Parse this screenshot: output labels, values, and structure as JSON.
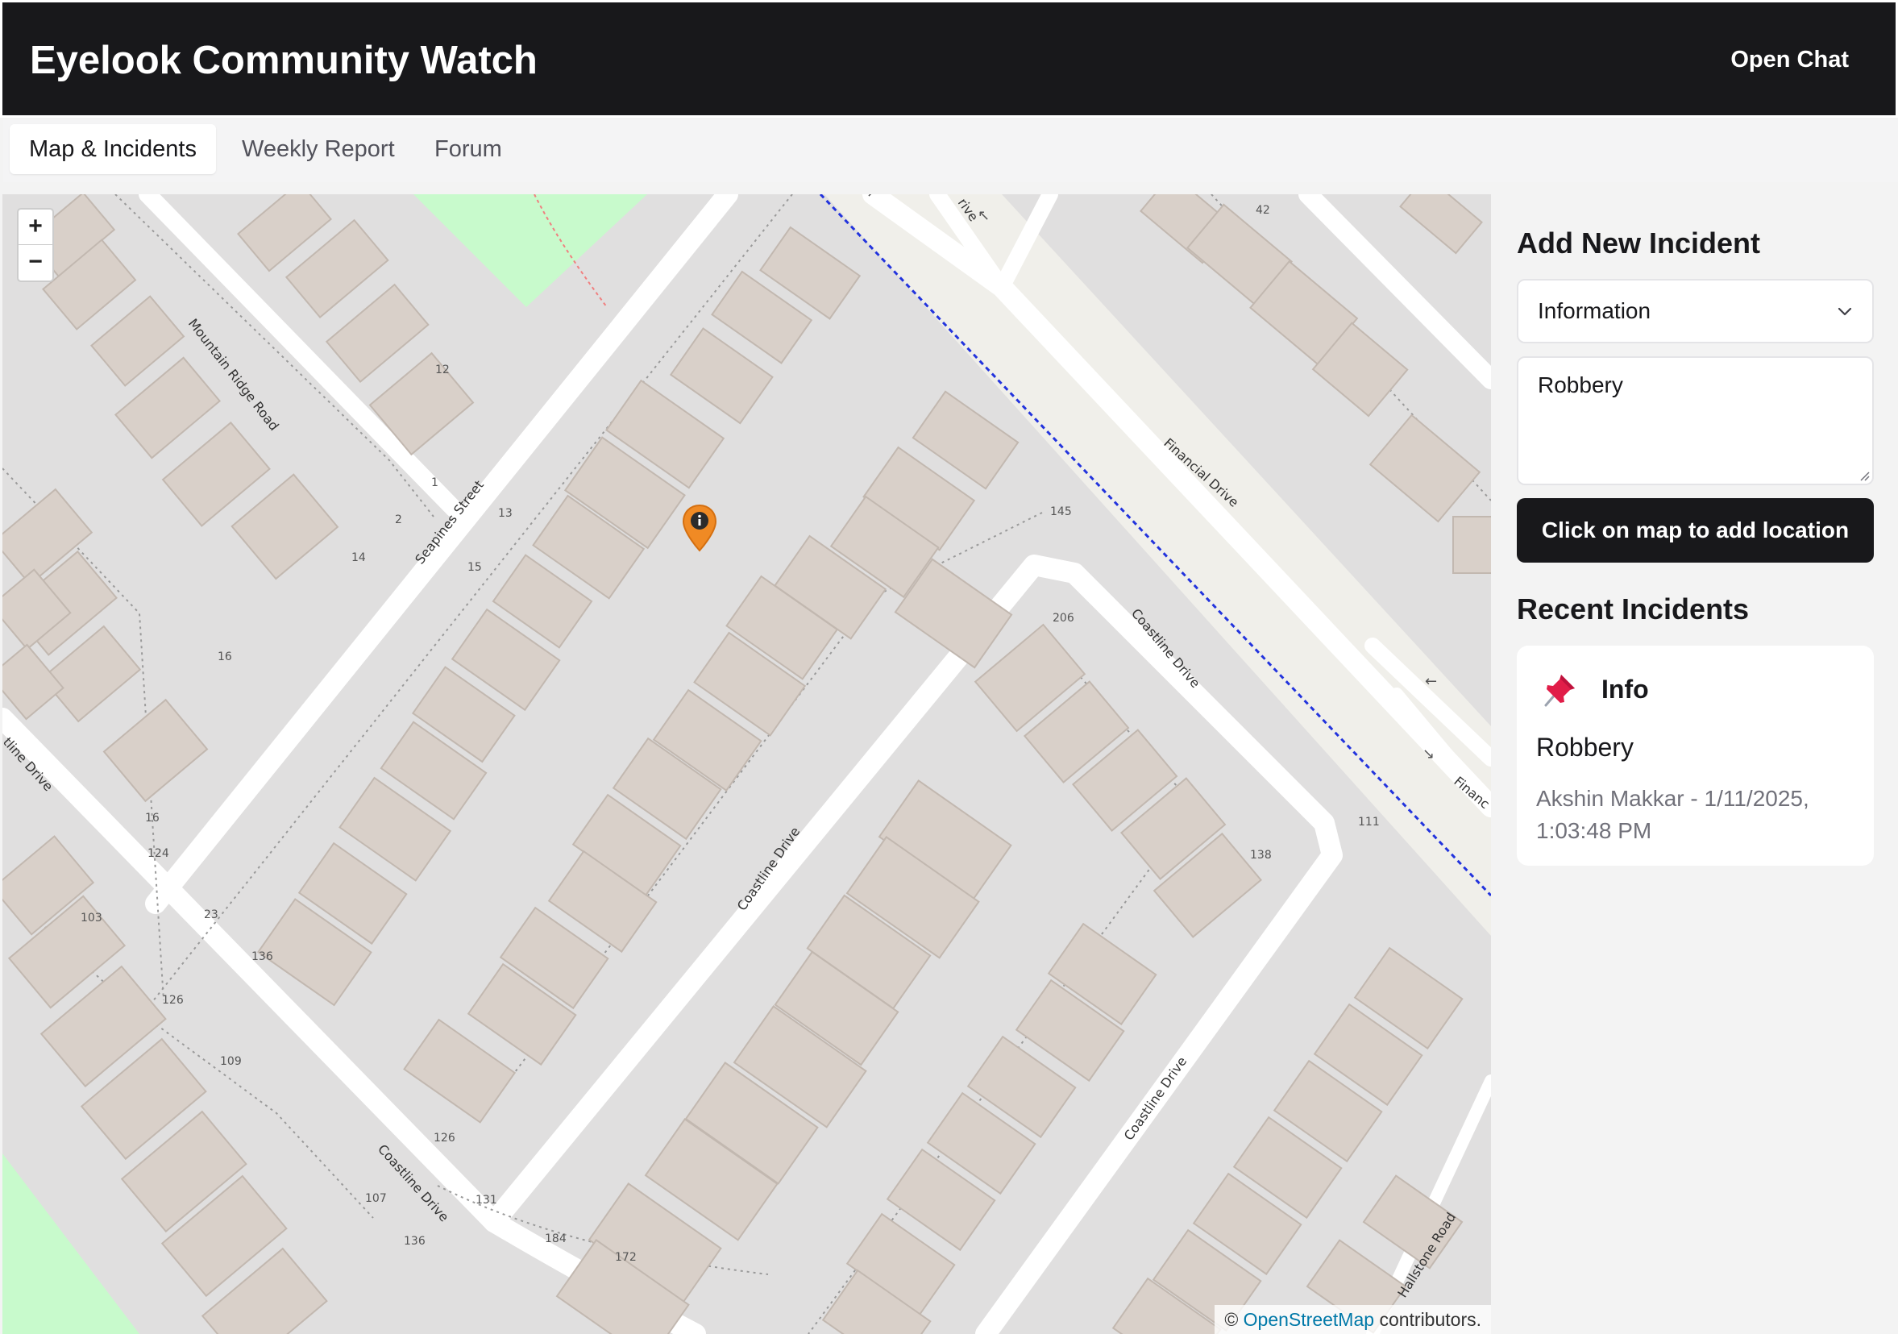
{
  "app": {
    "title": "Eyelook Community Watch",
    "open_chat": "Open Chat"
  },
  "tabs": [
    {
      "label": "Map & Incidents",
      "active": true
    },
    {
      "label": "Weekly Report",
      "active": false
    },
    {
      "label": "Forum",
      "active": false
    }
  ],
  "map": {
    "zoom_in": "+",
    "zoom_out": "−",
    "attribution_prefix": "©",
    "attribution_link": "OpenStreetMap",
    "attribution_suffix": "contributors.",
    "streets": [
      "Mountain Ridge Road",
      "Seapines Street",
      "Financial Drive",
      "Coastline Drive",
      "Coastline Drive",
      "Coastline Drive",
      "Coastline Drive",
      "Hallstone Road",
      "tline Drive",
      "Financ",
      "rive"
    ],
    "house_numbers": [
      "42",
      "12",
      "1",
      "2",
      "13",
      "14",
      "15",
      "145",
      "206",
      "16",
      "16",
      "124",
      "23",
      "103",
      "136",
      "126",
      "109",
      "126",
      "131",
      "107",
      "136",
      "184",
      "172",
      "111",
      "138"
    ],
    "marker": {
      "type": "info",
      "color": "#f08a24"
    }
  },
  "form": {
    "heading": "Add New Incident",
    "type_value": "Information",
    "description_value": "Robbery",
    "location_button": "Click on map to add location"
  },
  "recent": {
    "heading": "Recent Incidents",
    "items": [
      {
        "icon": "pushpin-icon",
        "type": "Info",
        "description": "Robbery",
        "meta": "Akshin Makkar - 1/11/2025, 1:03:48 PM"
      }
    ]
  }
}
